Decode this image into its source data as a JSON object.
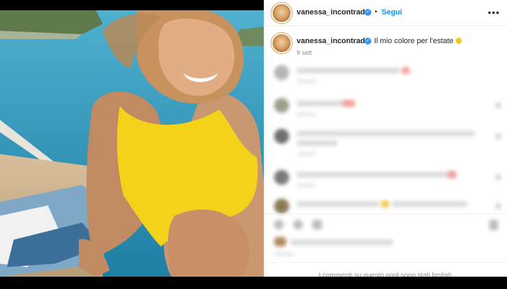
{
  "post": {
    "username": "vanessa_incontrada",
    "follow_label": "Segui",
    "separator": "•",
    "more_label": "•••",
    "verified_mark": "✓",
    "caption_text": "Il mio colore per l'estate",
    "caption_emoji": "sun-emoji",
    "time_ago": "9 sett",
    "comments_notice": "I commenti su questo post sono stati limitati."
  },
  "colors": {
    "accent": "#0095f6",
    "verified": "#3897f0",
    "swimsuit": "#f2d21a",
    "sea": "#2f8fb3"
  }
}
